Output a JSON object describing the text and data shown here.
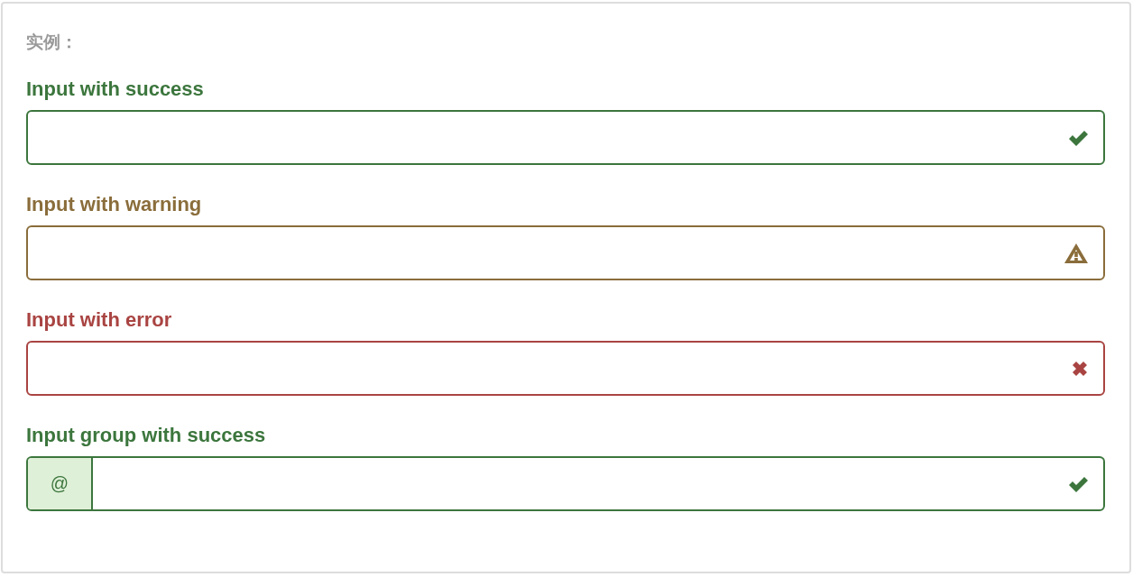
{
  "heading": "实例：",
  "fields": [
    {
      "label": "Input with success",
      "kind": "success"
    },
    {
      "label": "Input with warning",
      "kind": "warning"
    },
    {
      "label": "Input with error",
      "kind": "error"
    },
    {
      "label": "Input group with success",
      "kind": "success",
      "addon": "@"
    }
  ]
}
